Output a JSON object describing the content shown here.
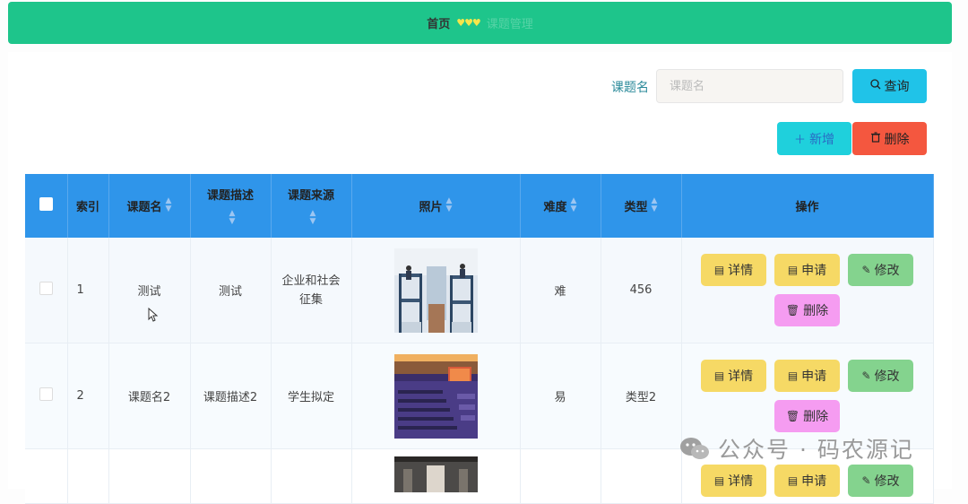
{
  "breadcrumb": {
    "home": "首页",
    "separator": "♥♥♥",
    "current": "课题管理"
  },
  "search": {
    "label": "课题名",
    "placeholder": "课题名",
    "value": "",
    "query_label": "查询"
  },
  "actions": {
    "add_label": "新增",
    "delete_label": "删除"
  },
  "table": {
    "headers": {
      "index": "索引",
      "name": "课题名",
      "desc": "课题描述",
      "source": "课题来源",
      "photo": "照片",
      "difficulty": "难度",
      "type": "类型",
      "ops": "操作"
    },
    "rows": [
      {
        "index": "1",
        "name": "测试",
        "desc": "测试",
        "source": "企业和社会征集",
        "difficulty": "难",
        "type": "456"
      },
      {
        "index": "2",
        "name": "课题名2",
        "desc": "课题描述2",
        "source": "学生拟定",
        "difficulty": "易",
        "type": "类型2"
      }
    ],
    "op_labels": {
      "detail": "详情",
      "apply": "申请",
      "edit": "修改",
      "delete": "删除"
    }
  },
  "watermark": "公众号 · 码农源记",
  "colors": {
    "topbar": "#1ec58b",
    "header": "#2f95ea",
    "query": "#20c3e8",
    "add": "#1fd0dc",
    "delete": "#f4573f",
    "detail": "#f6d965",
    "edit": "#84d38e",
    "row_delete": "#f59cf1"
  }
}
